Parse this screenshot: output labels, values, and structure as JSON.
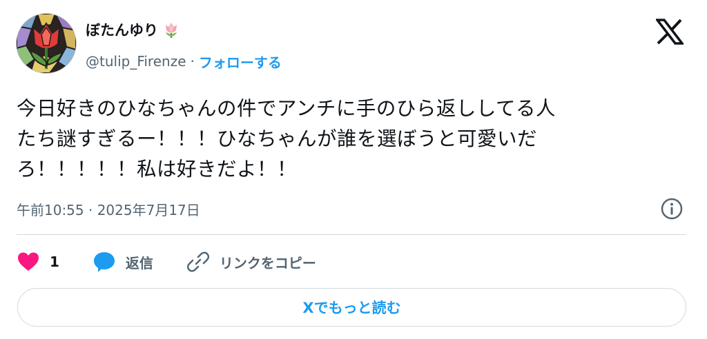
{
  "author": {
    "display_name": "ぼたんゆり",
    "name_emoji": "tulip-emoji",
    "handle": "@tulip_Firenze",
    "separator": "·",
    "follow_label": "フォローする",
    "avatar_icon": "stained-glass-tulip-avatar"
  },
  "brand_icon": "x-logo-icon",
  "tweet": {
    "text": "今日好きのひなちゃんの件でアンチに手のひら返ししてる人\nたち謎すぎるー！！！ひなちゃんが誰を選ぼうと可愛いだ\nろ！！！！！私は好きだよ！！"
  },
  "meta": {
    "timestamp": "午前10:55 · 2025年7月17日",
    "info_icon": "info-icon"
  },
  "actions": {
    "like_icon": "heart-icon",
    "like_count": "1",
    "reply_icon": "speech-bubble-icon",
    "reply_label": "返信",
    "copy_icon": "link-icon",
    "copy_label": "リンクをコピー"
  },
  "read_more_label": "Xでもっと読む",
  "colors": {
    "accent": "#1d9bf0",
    "like": "#f91880",
    "text": "#0f1419",
    "muted": "#536471",
    "border": "#cfd9de"
  }
}
